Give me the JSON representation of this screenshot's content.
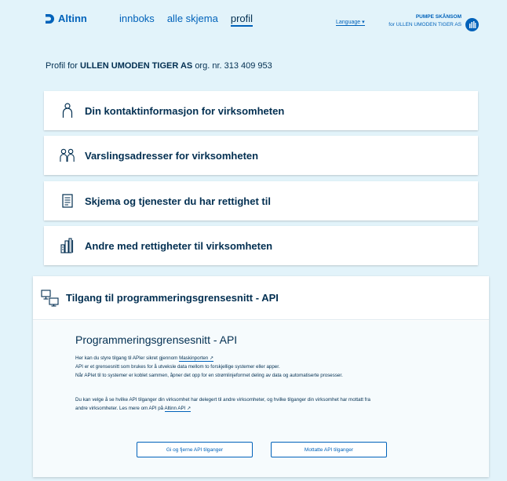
{
  "header": {
    "logo_text": "Altinn",
    "nav": [
      {
        "label": "innboks"
      },
      {
        "label": "alle skjema"
      },
      {
        "label": "profil"
      }
    ],
    "language": "Language",
    "user_name": "PUMPE SKÅNSOM",
    "user_org": "for ULLEN UMODEN TIGER AS"
  },
  "profile": {
    "prefix": "Profil for",
    "org_name": "ULLEN UMODEN TIGER AS",
    "org_suffix": "org. nr. 313 409 953"
  },
  "cards": [
    {
      "label": "Din kontaktinformasjon for virksomheten",
      "icon": "person-icon"
    },
    {
      "label": "Varslingsadresser for virksomheten",
      "icon": "people-icon"
    },
    {
      "label": "Skjema og tjenester du har rettighet til",
      "icon": "document-icon"
    },
    {
      "label": "Andre med rettigheter til virksomheten",
      "icon": "building-icon"
    }
  ],
  "api": {
    "header_label": "Tilgang til programmeringsgrensesnitt - API",
    "title": "Programmeringsgrensesnitt - API",
    "p1_text": "Her kan du styre tilgang til APIer sikret gjennom",
    "p1_link": "Maskinporten ↗",
    "p2": "API er et grensesnitt som brukes for å utveksle data mellom to forskjellige systemer eller apper.",
    "p3": "Når APIet til to systemer er koblet sammen, åpner det opp for en strømlinjeformet deling av data og automatiserte prosesser.",
    "p4": "Du kan velge å se hvilke API tilganger din virksomhet har delegert til andre virksomheter, og hvilke tilganger din virksomhet har mottatt fra",
    "p5_text": "andre virksomheter. Les mere om API på",
    "p5_link": "Altinn API ↗",
    "button_give": "Gi og fjerne API tilganger",
    "button_received": "Mottatte API tilganger"
  },
  "colors": {
    "background": "#e2f3fa",
    "brand_blue": "#0062ba",
    "text_dark": "#022f51"
  }
}
